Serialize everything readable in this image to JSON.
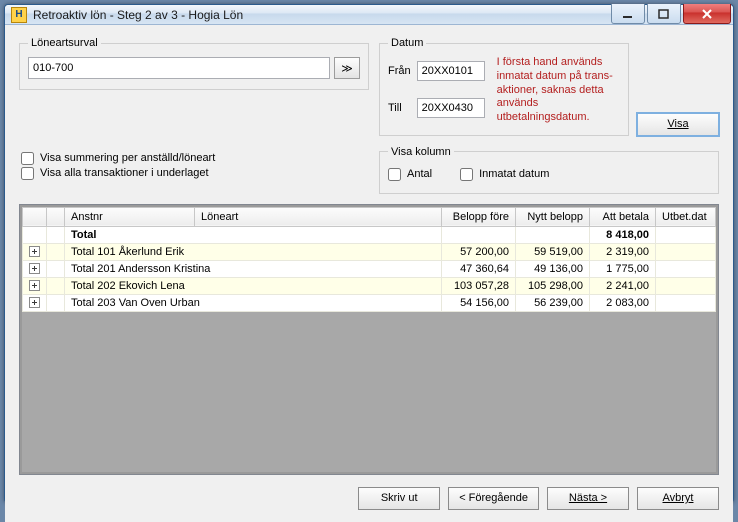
{
  "window": {
    "title": "Retroaktiv lön - Steg 2 av 3 - Hogia Lön"
  },
  "loneart": {
    "legend": "Löneartsurval",
    "value": "010-700"
  },
  "datum": {
    "legend": "Datum",
    "from_label": "Från",
    "from_value": "20XX0101",
    "to_label": "Till",
    "to_value": "20XX0430",
    "hint": "I första hand används inmatat datum på trans- aktioner, saknas detta används utbetalningsdatum."
  },
  "buttons": {
    "visa": "Visa",
    "print": "Skriv ut",
    "prev": "< Föregående",
    "next": "Nästa >",
    "cancel": "Avbryt"
  },
  "checks": {
    "summary": "Visa summering per anställd/löneart",
    "alltrans": "Visa alla transaktioner i underlaget"
  },
  "kolumn": {
    "legend": "Visa kolumn",
    "antal": "Antal",
    "inmatat": "Inmatat datum"
  },
  "grid": {
    "headers": {
      "anstnr": "Anstnr",
      "loneart": "Löneart",
      "belopp_fore": "Belopp före",
      "nytt_belopp": "Nytt belopp",
      "att_betala": "Att betala",
      "utbet_dat": "Utbet.dat"
    },
    "total_label": "Total",
    "total_att_betala": "8 418,00",
    "rows": [
      {
        "name": "Total 101 Åkerlund Erik",
        "belopp_fore": "57 200,00",
        "nytt_belopp": "59 519,00",
        "att_betala": "2 319,00"
      },
      {
        "name": "Total 201 Andersson Kristina",
        "belopp_fore": "47 360,64",
        "nytt_belopp": "49 136,00",
        "att_betala": "1 775,00"
      },
      {
        "name": "Total 202 Ekovich Lena",
        "belopp_fore": "103 057,28",
        "nytt_belopp": "105 298,00",
        "att_betala": "2 241,00"
      },
      {
        "name": "Total 203 Van Oven Urban",
        "belopp_fore": "54 156,00",
        "nytt_belopp": "56 239,00",
        "att_betala": "2 083,00"
      }
    ]
  }
}
